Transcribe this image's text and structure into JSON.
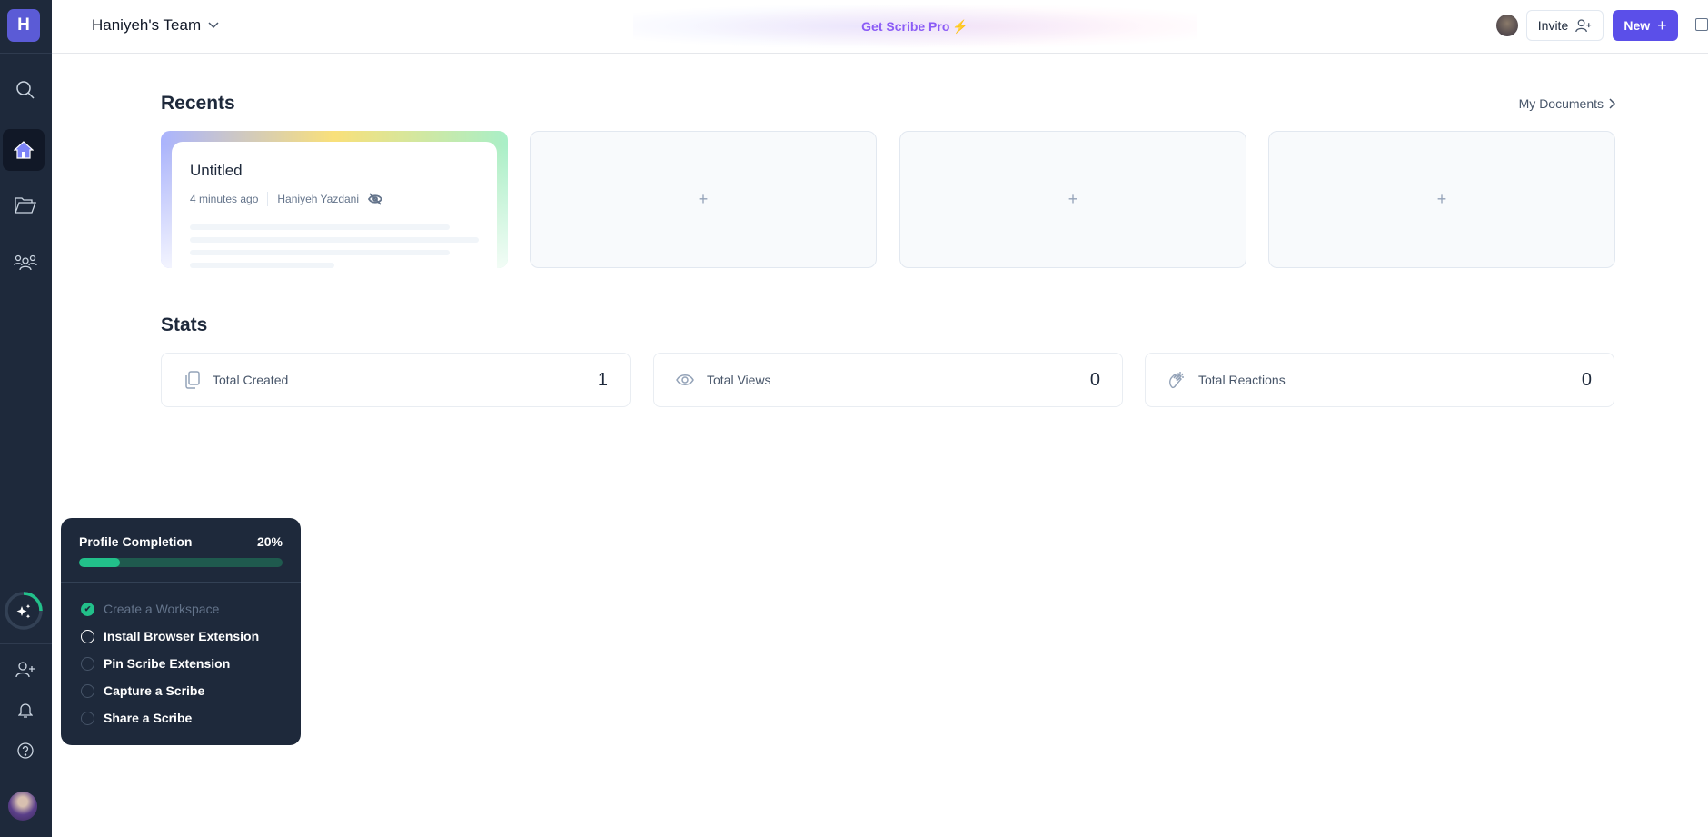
{
  "sidebar": {
    "logo": "H",
    "items": [
      "search",
      "home",
      "documents",
      "team"
    ],
    "bottom": [
      "invite-user",
      "notifications",
      "help",
      "profile"
    ]
  },
  "header": {
    "team": "Haniyeh's Team",
    "promo": "Get Scribe Pro",
    "promo_icon": "⚡",
    "invite": "Invite",
    "new": "New"
  },
  "recents": {
    "title": "Recents",
    "link": "My Documents",
    "doc": {
      "title": "Untitled",
      "time": "4 minutes ago",
      "author": "Haniyeh Yazdani"
    },
    "placeholder": "+"
  },
  "stats": {
    "title": "Stats",
    "items": [
      {
        "label": "Total Created",
        "value": "1"
      },
      {
        "label": "Total Views",
        "value": "0"
      },
      {
        "label": "Total Reactions",
        "value": "0"
      }
    ]
  },
  "profile": {
    "title": "Profile Completion",
    "percent_label": "20%",
    "percent": 20,
    "tasks": [
      {
        "label": "Create a Workspace",
        "done": true
      },
      {
        "label": "Install Browser Extension",
        "done": false
      },
      {
        "label": "Pin Scribe Extension",
        "done": false
      },
      {
        "label": "Capture a Scribe",
        "done": false
      },
      {
        "label": "Share a Scribe",
        "done": false
      }
    ]
  },
  "colors": {
    "accent": "#5b4fe9",
    "sidebar": "#1e293b",
    "success": "#22c08a"
  }
}
